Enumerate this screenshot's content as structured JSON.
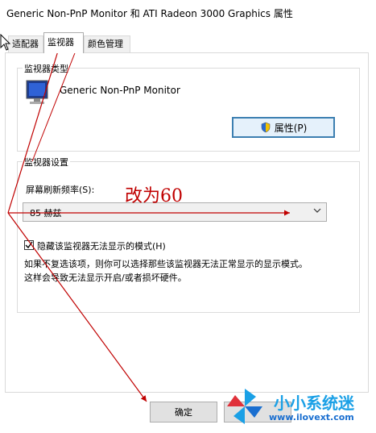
{
  "window": {
    "title": "Generic Non-PnP Monitor 和 ATI Radeon 3000 Graphics 属性"
  },
  "tabs": [
    {
      "label": "适配器",
      "active": false
    },
    {
      "label": "监视器",
      "active": true
    },
    {
      "label": "颜色管理",
      "active": false
    }
  ],
  "monitor_type": {
    "group_title": "监视器类型",
    "monitor_name": "Generic Non-PnP Monitor",
    "properties_button": "属性(P)",
    "icon": "monitor-icon"
  },
  "monitor_settings": {
    "group_title": "监视器设置",
    "refresh_label": "屏幕刷新频率(S):",
    "refresh_value": "85 赫兹",
    "hide_modes_checked": true,
    "hide_modes_label": "隐藏该监视器无法显示的模式(H)",
    "description_line1": "如果不复选该项，则你可以选择那些该监视器无法正常显示的显示模式。",
    "description_line2": "这样会导致无法显示开启/或者损坏硬件。"
  },
  "footer": {
    "ok_label": "确定"
  },
  "annotation": {
    "text": "改为60",
    "color": "#c00000"
  },
  "watermark": {
    "brand": "小小系统迷",
    "url": "www.ilovext.com"
  }
}
